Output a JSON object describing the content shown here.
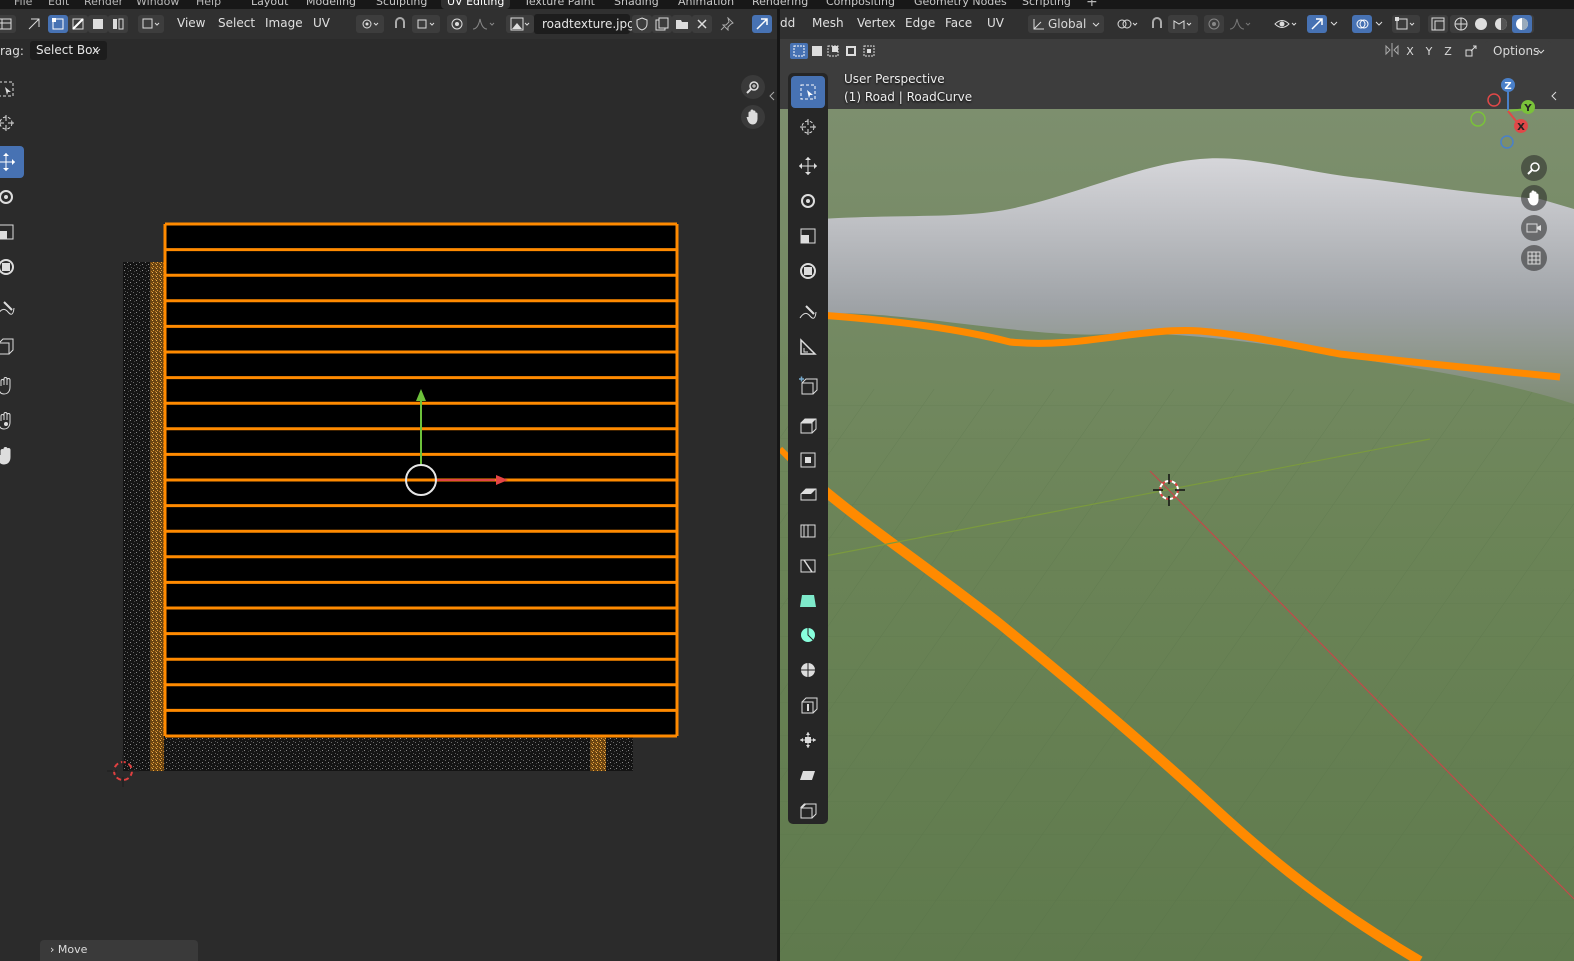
{
  "workspaces": {
    "menu_left": [
      "File",
      "Edit",
      "Render",
      "Window",
      "Help"
    ],
    "tabs": [
      "Layout",
      "Modeling",
      "Sculpting",
      "UV Editing",
      "Texture Paint",
      "Shading",
      "Animation",
      "Rendering",
      "Compositing",
      "Geometry Nodes",
      "Scripting"
    ],
    "active_tab": "UV Editing"
  },
  "uv_editor": {
    "menus": {
      "view": "View",
      "select": "Select",
      "image": "Image",
      "uv": "UV"
    },
    "image_name": "roadtexture.jpg",
    "drag_label": "rag:",
    "drag_value": "Select Box",
    "last_op": "Move"
  },
  "viewport": {
    "menus": {
      "add": "dd",
      "mesh": "Mesh",
      "vertex": "Vertex",
      "edge": "Edge",
      "face": "Face",
      "uv": "UV"
    },
    "orientation": "Global",
    "options": "Options",
    "axis_lock": {
      "x": "X",
      "y": "Y",
      "z": "Z"
    },
    "perspective_label": "User Perspective",
    "object_label": "(1) Road | RoadCurve",
    "gizmo": {
      "x": "X",
      "y": "Y",
      "z": "Z"
    }
  },
  "colors": {
    "accent": "#4772b3",
    "uv_edge": "#ff8a00",
    "ground": "#6f8a5a",
    "mountain": "#c4c4ca"
  }
}
